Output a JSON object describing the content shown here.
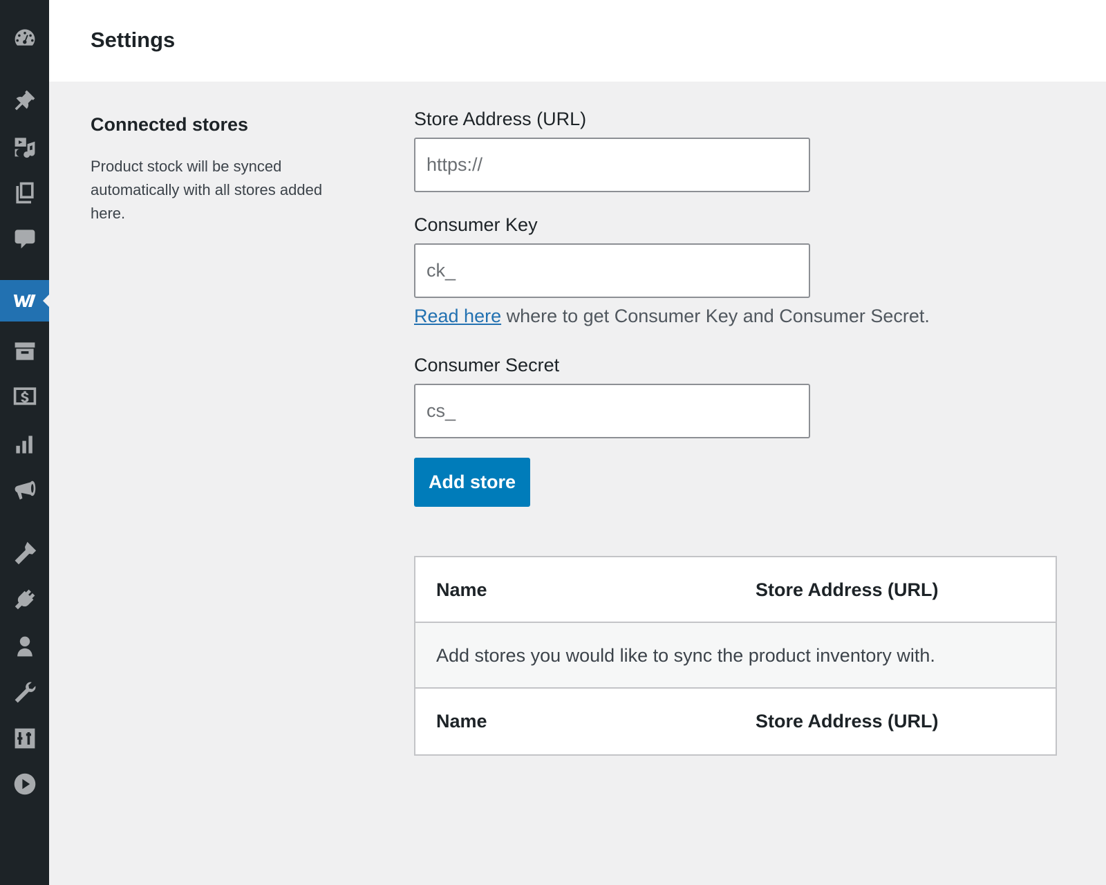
{
  "sidebar": {
    "items": [
      {
        "icon": "dashboard-icon"
      },
      {
        "icon": "pin-icon"
      },
      {
        "icon": "media-icon"
      },
      {
        "icon": "pages-icon"
      },
      {
        "icon": "comments-icon"
      },
      {
        "icon": "woocommerce-icon",
        "active": true
      },
      {
        "icon": "archive-icon"
      },
      {
        "icon": "money-icon"
      },
      {
        "icon": "analytics-icon"
      },
      {
        "icon": "megaphone-icon"
      },
      {
        "icon": "appearance-icon"
      },
      {
        "icon": "plugins-icon"
      },
      {
        "icon": "users-icon"
      },
      {
        "icon": "tools-icon"
      },
      {
        "icon": "settings-sliders-icon"
      },
      {
        "icon": "play-icon"
      }
    ],
    "colors": {
      "background": "#1d2327",
      "active": "#2271b1",
      "icon": "#a7aaad"
    }
  },
  "header": {
    "title": "Settings"
  },
  "section": {
    "heading": "Connected stores",
    "description": "Product stock will be synced automatically with all stores added here."
  },
  "form": {
    "store_url": {
      "label": "Store Address (URL)",
      "placeholder": "https://",
      "value": ""
    },
    "consumer_key": {
      "label": "Consumer Key",
      "placeholder": "ck_",
      "value": ""
    },
    "help": {
      "link_text": "Read here",
      "text": " where to get Consumer Key and Consumer Secret."
    },
    "consumer_secret": {
      "label": "Consumer Secret",
      "placeholder": "cs_",
      "value": ""
    },
    "submit_label": "Add store"
  },
  "table": {
    "columns": [
      "Name",
      "Store Address (URL)"
    ],
    "empty_message": "Add stores you would like to sync the product inventory with.",
    "footer_columns": [
      "Name",
      "Store Address (URL)"
    ]
  },
  "colors": {
    "accent": "#007cba",
    "link": "#2271b1",
    "page_background": "#f0f0f1"
  }
}
